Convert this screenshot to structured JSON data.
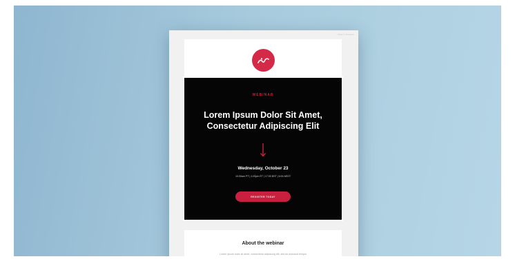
{
  "colors": {
    "background_gradient_start": "#8fb6d0",
    "background_gradient_end": "#b6d6e6",
    "accent": "#c8203e",
    "hero_background": "#050505"
  },
  "email": {
    "top_meta": "View in browser",
    "logo_icon": "brand-mark-icon",
    "hero": {
      "eyebrow": "WEBINAR",
      "title": "Lorem Ipsum Dolor Sit Amet, Consectetur Adipiscing Elit",
      "arrow_icon": "arrow-down-icon",
      "date": "Wednesday, October 23",
      "times": "10:00am PT | 1:00pm ET | 17:00 BST | 6:00 AEDT",
      "cta_label": "REGISTER TODAY"
    },
    "about": {
      "heading": "About the webinar",
      "body": "Lorem ipsum dolor sit amet, consectetur adipiscing elit, sed do eiusmod tempor"
    }
  }
}
